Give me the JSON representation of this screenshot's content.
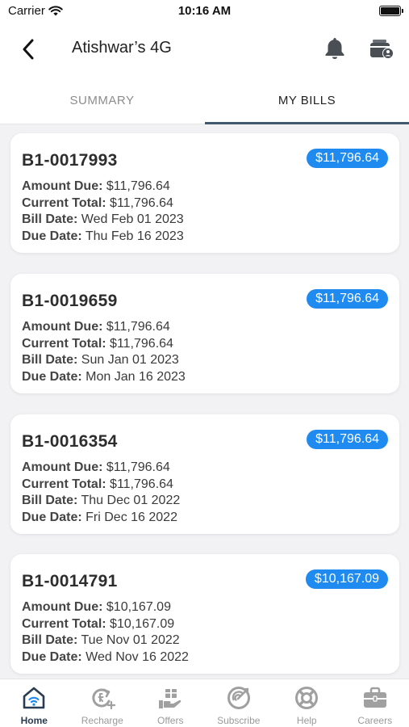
{
  "status_bar": {
    "carrier": "Carrier",
    "time": "10:16 AM"
  },
  "nav": {
    "title": "Atishwar’s 4G"
  },
  "tabs": [
    {
      "label": "SUMMARY",
      "active": false
    },
    {
      "label": "MY BILLS",
      "active": true
    }
  ],
  "bill_field_labels": {
    "amount_due": "Amount Due:",
    "current_total": "Current Total:",
    "bill_date": "Bill Date:",
    "due_date": "Due Date:"
  },
  "bills": [
    {
      "id": "B1-0017993",
      "badge": "$11,796.64",
      "amount_due": "$11,796.64",
      "current_total": "$11,796.64",
      "bill_date": "Wed Feb 01 2023",
      "due_date": "Thu Feb 16 2023"
    },
    {
      "id": "B1-0019659",
      "badge": "$11,796.64",
      "amount_due": "$11,796.64",
      "current_total": "$11,796.64",
      "bill_date": "Sun Jan 01 2023",
      "due_date": "Mon Jan 16 2023"
    },
    {
      "id": "B1-0016354",
      "badge": "$11,796.64",
      "amount_due": "$11,796.64",
      "current_total": "$11,796.64",
      "bill_date": "Thu Dec 01 2022",
      "due_date": "Fri Dec 16 2022"
    },
    {
      "id": "B1-0014791",
      "badge": "$10,167.09",
      "amount_due": "$10,167.09",
      "current_total": "$10,167.09",
      "bill_date": "Tue Nov 01 2022",
      "due_date": "Wed Nov 16 2022"
    }
  ],
  "tabbar": [
    {
      "label": "Home",
      "icon": "home-wifi-icon",
      "active": true
    },
    {
      "label": "Recharge",
      "icon": "recharge-icon",
      "active": false
    },
    {
      "label": "Offers",
      "icon": "offers-gift-hand-icon",
      "active": false
    },
    {
      "label": "Subscribe",
      "icon": "subscribe-signal-icon",
      "active": false
    },
    {
      "label": "Help",
      "icon": "help-lifebuoy-icon",
      "active": false
    },
    {
      "label": "Careers",
      "icon": "careers-briefcase-icon",
      "active": false
    }
  ],
  "colors": {
    "accent": "#1f8af0",
    "tab_underline": "#3f5970",
    "active_tab": "#2a3c52",
    "background": "#f2f2f4"
  }
}
